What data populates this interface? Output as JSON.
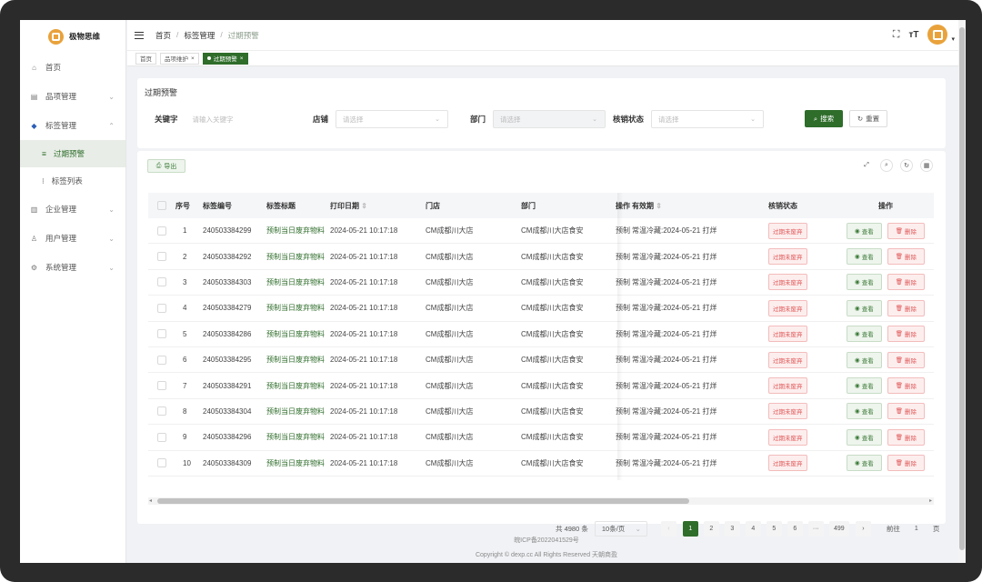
{
  "app": {
    "name": "极物思维"
  },
  "sidebar": {
    "items": [
      {
        "label": "首页",
        "icon": "home-icon"
      },
      {
        "label": "品项管理",
        "icon": "folder-icon"
      },
      {
        "label": "标签管理",
        "icon": "tag-icon"
      },
      {
        "label": "过期预警",
        "icon": "warning-icon"
      },
      {
        "label": "标签列表",
        "icon": "list-icon"
      },
      {
        "label": "企业管理",
        "icon": "building-icon"
      },
      {
        "label": "用户管理",
        "icon": "user-icon"
      },
      {
        "label": "系统管理",
        "icon": "gear-icon"
      }
    ]
  },
  "breadcrumb": {
    "home": "首页",
    "parent": "标签管理",
    "current": "过期预警",
    "sep": "/"
  },
  "tags": [
    {
      "label": "首页"
    },
    {
      "label": "品项维护",
      "close": "×"
    },
    {
      "label": "过期预警",
      "close": "×"
    }
  ],
  "search": {
    "title": "过期预警",
    "keyword_label": "关键字",
    "keyword_placeholder": "请输入关键字",
    "store_label": "店铺",
    "store_placeholder": "请选择",
    "dept_label": "部门",
    "dept_placeholder": "请选择",
    "status_label": "核销状态",
    "status_placeholder": "请选择",
    "search_btn": "搜索",
    "reset_btn": "重置"
  },
  "toolbar": {
    "export": "导出"
  },
  "table": {
    "headers": {
      "no": "序号",
      "code": "标签编号",
      "title": "标签标题",
      "date": "打印日期",
      "store": "门店",
      "dept": "部门",
      "op_hidden": "操作",
      "validity": "有效期",
      "status": "核销状态",
      "actions": "操作"
    },
    "view_label": "查看",
    "delete_label": "删除",
    "rows": [
      {
        "no": "1",
        "code": "240503384299",
        "title": "预制当日废弃物料",
        "date": "2024-05-21 10:17:18",
        "store": "CM成都川大店",
        "dept": "CM成都川大店食安",
        "op": "预制",
        "validity": "常温冷藏:2024-05-21 打烊",
        "status": "过期未废弃"
      },
      {
        "no": "2",
        "code": "240503384292",
        "title": "预制当日废弃物料",
        "date": "2024-05-21 10:17:18",
        "store": "CM成都川大店",
        "dept": "CM成都川大店食安",
        "op": "预制",
        "validity": "常温冷藏:2024-05-21 打烊",
        "status": "过期未废弃"
      },
      {
        "no": "3",
        "code": "240503384303",
        "title": "预制当日废弃物料",
        "date": "2024-05-21 10:17:18",
        "store": "CM成都川大店",
        "dept": "CM成都川大店食安",
        "op": "预制",
        "validity": "常温冷藏:2024-05-21 打烊",
        "status": "过期未废弃"
      },
      {
        "no": "4",
        "code": "240503384279",
        "title": "预制当日废弃物料",
        "date": "2024-05-21 10:17:18",
        "store": "CM成都川大店",
        "dept": "CM成都川大店食安",
        "op": "预制",
        "validity": "常温冷藏:2024-05-21 打烊",
        "status": "过期未废弃"
      },
      {
        "no": "5",
        "code": "240503384286",
        "title": "预制当日废弃物料",
        "date": "2024-05-21 10:17:18",
        "store": "CM成都川大店",
        "dept": "CM成都川大店食安",
        "op": "预制",
        "validity": "常温冷藏:2024-05-21 打烊",
        "status": "过期未废弃"
      },
      {
        "no": "6",
        "code": "240503384295",
        "title": "预制当日废弃物料",
        "date": "2024-05-21 10:17:18",
        "store": "CM成都川大店",
        "dept": "CM成都川大店食安",
        "op": "预制",
        "validity": "常温冷藏:2024-05-21 打烊",
        "status": "过期未废弃"
      },
      {
        "no": "7",
        "code": "240503384291",
        "title": "预制当日废弃物料",
        "date": "2024-05-21 10:17:18",
        "store": "CM成都川大店",
        "dept": "CM成都川大店食安",
        "op": "预制",
        "validity": "常温冷藏:2024-05-21 打烊",
        "status": "过期未废弃"
      },
      {
        "no": "8",
        "code": "240503384304",
        "title": "预制当日废弃物料",
        "date": "2024-05-21 10:17:18",
        "store": "CM成都川大店",
        "dept": "CM成都川大店食安",
        "op": "预制",
        "validity": "常温冷藏:2024-05-21 打烊",
        "status": "过期未废弃"
      },
      {
        "no": "9",
        "code": "240503384296",
        "title": "预制当日废弃物料",
        "date": "2024-05-21 10:17:18",
        "store": "CM成都川大店",
        "dept": "CM成都川大店食安",
        "op": "预制",
        "validity": "常温冷藏:2024-05-21 打烊",
        "status": "过期未废弃"
      },
      {
        "no": "10",
        "code": "240503384309",
        "title": "预制当日废弃物料",
        "date": "2024-05-21 10:17:18",
        "store": "CM成都川大店",
        "dept": "CM成都川大店食安",
        "op": "预制",
        "validity": "常温冷藏:2024-05-21 打烊",
        "status": "过期未废弃"
      }
    ]
  },
  "pagination": {
    "total": "共 4980 条",
    "page_size": "10条/页",
    "pages": [
      "1",
      "2",
      "3",
      "4",
      "5",
      "6",
      "···",
      "499"
    ],
    "goto_label": "前往",
    "goto_value": "1",
    "page_unit": "页"
  },
  "footer": {
    "icp": "皖ICP备2022041529号",
    "copyright": "Copyright © dexp.cc All Rights Reserved 天朝商盈"
  },
  "colors": {
    "primary": "#2e6d2a",
    "danger": "#e05656",
    "logo": "#e9a23b"
  }
}
